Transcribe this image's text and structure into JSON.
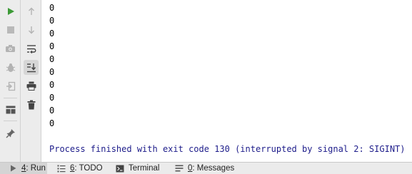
{
  "console": {
    "lines": [
      "0",
      "0",
      "0",
      "0",
      "0",
      "0",
      "0",
      "0",
      "0",
      "0"
    ],
    "exit_message": "Process finished with exit code 130 (interrupted by signal 2: SIGINT)"
  },
  "toolbar_left": {
    "icons": [
      "run-icon",
      "stop-icon",
      "camera-icon",
      "debug-icon",
      "exit-icon",
      "layout-icon",
      "pin-icon"
    ]
  },
  "toolbar_right": {
    "icons": [
      "arrow-up-icon",
      "arrow-down-icon",
      "soft-wrap-icon",
      "scroll-to-end-icon",
      "print-icon",
      "trash-icon"
    ]
  },
  "statusbar": {
    "tabs": [
      {
        "mnemonic": "4",
        "label": ": Run",
        "active": true
      },
      {
        "mnemonic": "6",
        "label": ": TODO",
        "active": false
      },
      {
        "mnemonic": "",
        "label": "Terminal",
        "active": false
      },
      {
        "mnemonic": "0",
        "label": ": Messages",
        "active": false
      }
    ]
  },
  "colors": {
    "run_green": "#3c9a36",
    "exit_text": "#1d1c8a",
    "toolbar_bg": "#ececec",
    "icon_gray": "#9a9a9a",
    "icon_dark": "#555555"
  }
}
